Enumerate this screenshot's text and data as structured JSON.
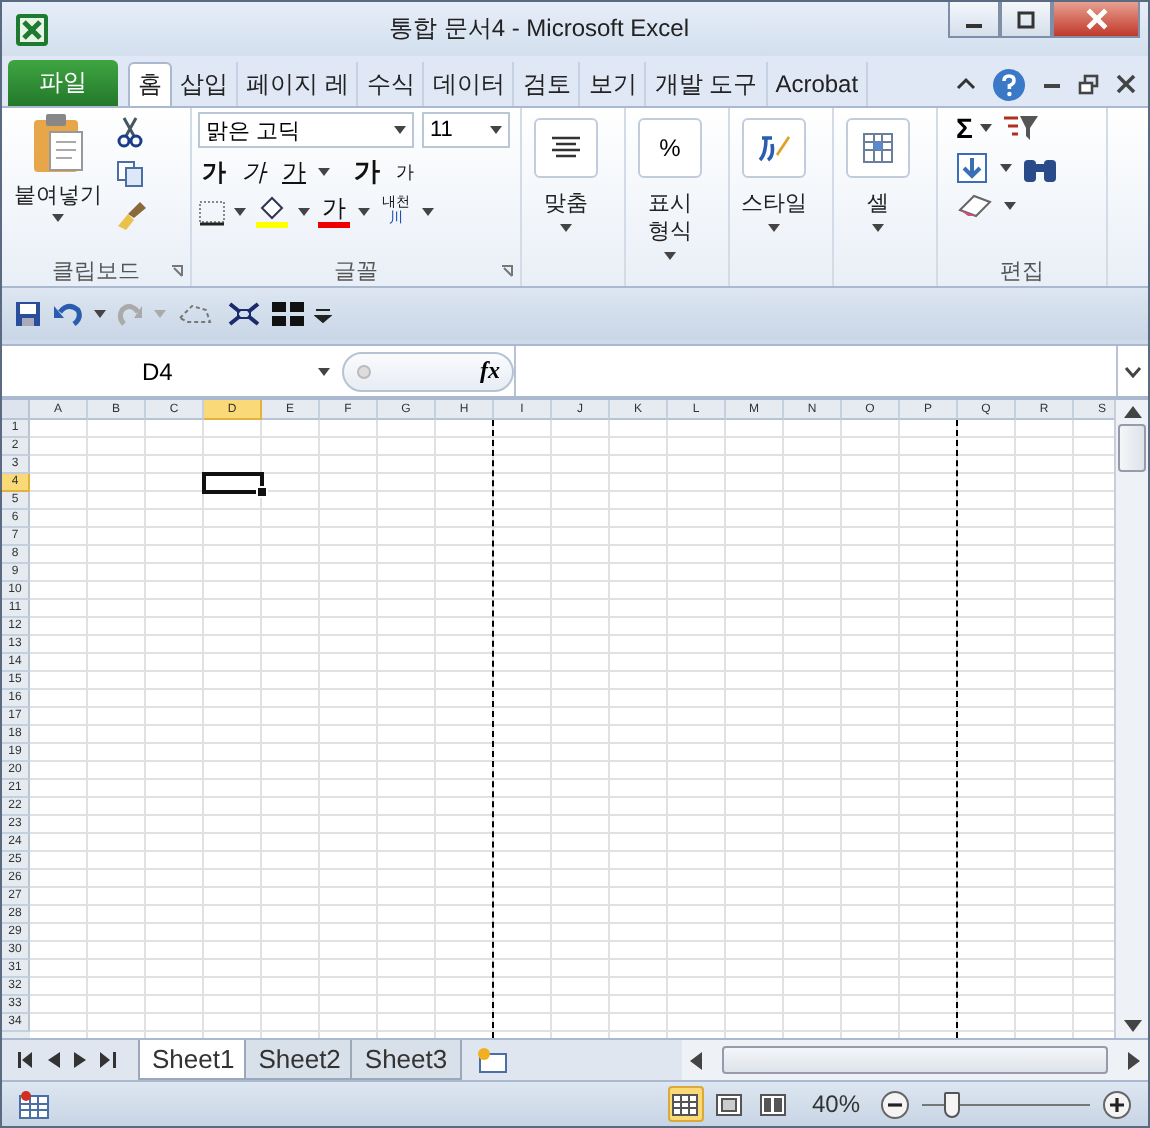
{
  "window": {
    "title": "통합 문서4  -  Microsoft Excel"
  },
  "file_tab": {
    "label": "파일"
  },
  "tabs": [
    {
      "label": "홈",
      "selected": true
    },
    {
      "label": "삽입",
      "selected": false
    },
    {
      "label": "페이지 레",
      "selected": false
    },
    {
      "label": "수식",
      "selected": false
    },
    {
      "label": "데이터",
      "selected": false
    },
    {
      "label": "검토",
      "selected": false
    },
    {
      "label": "보기",
      "selected": false
    },
    {
      "label": "개발 도구",
      "selected": false
    },
    {
      "label": "Acrobat",
      "selected": false
    }
  ],
  "ribbon": {
    "clipboard": {
      "paste": "붙여넣기",
      "label": "클립보드"
    },
    "font": {
      "name": "맑은 고딕",
      "size": "11",
      "label": "글꼴",
      "bold": "가",
      "italic": "가",
      "underline": "가",
      "grow": "가",
      "shrink": "가",
      "font_color_glyph": "가",
      "phonetic_top": "내천",
      "phonetic_bottom": "川"
    },
    "big_buttons": [
      {
        "kind": "align",
        "label": "맞춤"
      },
      {
        "kind": "number",
        "glyph": "%",
        "label": "표시\n형식"
      },
      {
        "kind": "style",
        "label": "스타일"
      },
      {
        "kind": "cells",
        "label": "셀"
      }
    ],
    "editing": {
      "sum": "Σ",
      "label": "편집"
    }
  },
  "formula_bar": {
    "name_box": "D4",
    "fx": "fx"
  },
  "columns": [
    {
      "label": "A",
      "selected": false,
      "page_break_after": false
    },
    {
      "label": "B",
      "selected": false,
      "page_break_after": false
    },
    {
      "label": "C",
      "selected": false,
      "page_break_after": false
    },
    {
      "label": "D",
      "selected": true,
      "page_break_after": false
    },
    {
      "label": "E",
      "selected": false,
      "page_break_after": false
    },
    {
      "label": "F",
      "selected": false,
      "page_break_after": false
    },
    {
      "label": "G",
      "selected": false,
      "page_break_after": false
    },
    {
      "label": "H",
      "selected": false,
      "page_break_after": true
    },
    {
      "label": "I",
      "selected": false,
      "page_break_after": false
    },
    {
      "label": "J",
      "selected": false,
      "page_break_after": false
    },
    {
      "label": "K",
      "selected": false,
      "page_break_after": false
    },
    {
      "label": "L",
      "selected": false,
      "page_break_after": false
    },
    {
      "label": "M",
      "selected": false,
      "page_break_after": false
    },
    {
      "label": "N",
      "selected": false,
      "page_break_after": false
    },
    {
      "label": "O",
      "selected": false,
      "page_break_after": false
    },
    {
      "label": "P",
      "selected": false,
      "page_break_after": true
    },
    {
      "label": "Q",
      "selected": false,
      "page_break_after": false
    },
    {
      "label": "R",
      "selected": false,
      "page_break_after": false
    },
    {
      "label": "S",
      "selected": false,
      "page_break_after": false
    }
  ],
  "rows": [
    {
      "label": "1",
      "selected": false
    },
    {
      "label": "2",
      "selected": false
    },
    {
      "label": "3",
      "selected": false
    },
    {
      "label": "4",
      "selected": true
    },
    {
      "label": "5",
      "selected": false
    },
    {
      "label": "6",
      "selected": false
    },
    {
      "label": "7",
      "selected": false
    },
    {
      "label": "8",
      "selected": false
    },
    {
      "label": "9",
      "selected": false
    },
    {
      "label": "10",
      "selected": false
    },
    {
      "label": "11",
      "selected": false
    },
    {
      "label": "12",
      "selected": false
    },
    {
      "label": "13",
      "selected": false
    },
    {
      "label": "14",
      "selected": false
    },
    {
      "label": "15",
      "selected": false
    },
    {
      "label": "16",
      "selected": false
    },
    {
      "label": "17",
      "selected": false
    },
    {
      "label": "18",
      "selected": false
    },
    {
      "label": "19",
      "selected": false
    },
    {
      "label": "20",
      "selected": false
    },
    {
      "label": "21",
      "selected": false
    },
    {
      "label": "22",
      "selected": false
    },
    {
      "label": "23",
      "selected": false
    },
    {
      "label": "24",
      "selected": false
    },
    {
      "label": "25",
      "selected": false
    },
    {
      "label": "26",
      "selected": false
    },
    {
      "label": "27",
      "selected": false
    },
    {
      "label": "28",
      "selected": false
    },
    {
      "label": "29",
      "selected": false
    },
    {
      "label": "30",
      "selected": false
    },
    {
      "label": "31",
      "selected": false
    },
    {
      "label": "32",
      "selected": false
    },
    {
      "label": "33",
      "selected": false
    },
    {
      "label": "34",
      "selected": false
    }
  ],
  "sheet_tabs": [
    {
      "label": "Sheet1",
      "selected": true
    },
    {
      "label": "Sheet2",
      "selected": false
    },
    {
      "label": "Sheet3",
      "selected": false
    }
  ],
  "status_bar": {
    "views": [
      {
        "kind": "normal",
        "selected": true
      },
      {
        "kind": "layout",
        "selected": false
      },
      {
        "kind": "break",
        "selected": false
      }
    ],
    "zoom": "40%",
    "zoom_slider": {
      "level": 0.18
    }
  }
}
